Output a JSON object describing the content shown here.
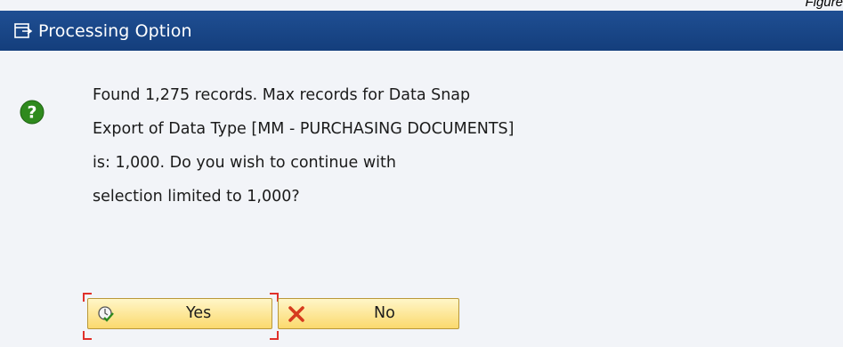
{
  "figure_label": "Figure",
  "dialog": {
    "title": "Processing Option",
    "title_icon": "dialog-window-icon",
    "message_icon": "question-icon",
    "message_lines": [
      "Found 1,275 records. Max records for Data Snap",
      "Export of Data Type [MM - PURCHASING DOCUMENTS]",
      "is: 1,000. Do you wish to continue with",
      "selection limited to 1,000?"
    ],
    "buttons": {
      "yes": {
        "label": "Yes",
        "icon": "confirm-check-icon",
        "focused": true
      },
      "no": {
        "label": "No",
        "icon": "cancel-x-icon"
      }
    }
  },
  "colors": {
    "titlebar": "#1f4f93",
    "question_icon": "#2f8a1e",
    "button_fill": "#fbd96d",
    "focus_marker": "#e0302a",
    "cancel_x": "#d63a1e"
  }
}
